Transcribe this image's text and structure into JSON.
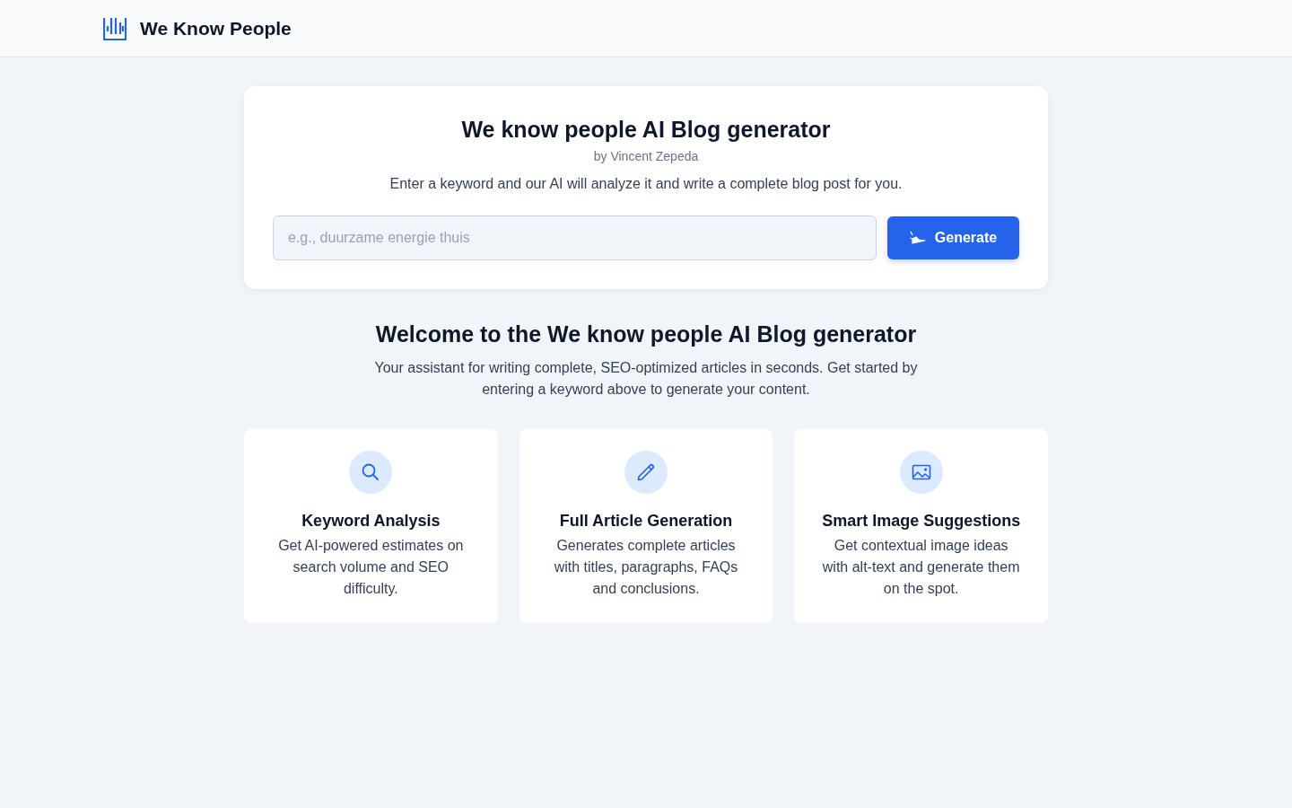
{
  "header": {
    "brand": "We Know People"
  },
  "generator": {
    "title": "We know people AI Blog generator",
    "byline": "by Vincent Zepeda",
    "description": "Enter a keyword and our AI will analyze it and write a complete blog post for you.",
    "input": {
      "placeholder": "e.g., duurzame energie thuis"
    },
    "button": "Generate"
  },
  "welcome": {
    "title": "Welcome to the We know people AI Blog generator",
    "text": "Your assistant for writing complete, SEO-optimized articles in seconds. Get started by entering a keyword above to generate your content."
  },
  "features": [
    {
      "title": "Keyword Analysis",
      "text": "Get AI-powered estimates on search volume and SEO difficulty."
    },
    {
      "title": "Full Article Generation",
      "text": "Generates complete articles with titles, paragraphs, FAQs and conclusions."
    },
    {
      "title": "Smart Image Suggestions",
      "text": "Get contextual image ideas with alt-text and generate them on the spot."
    }
  ]
}
